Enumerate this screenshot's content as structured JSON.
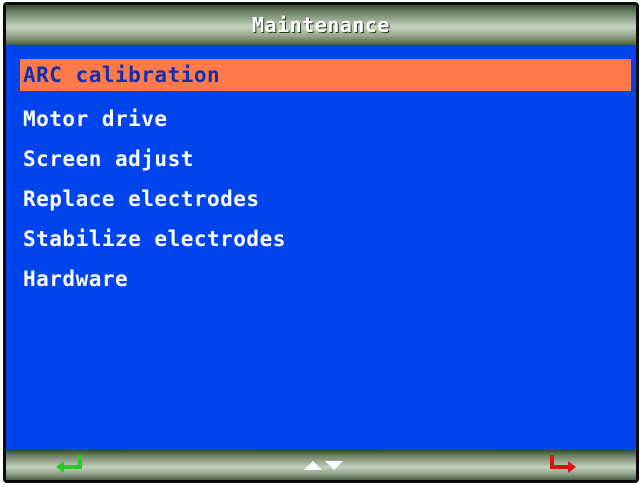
{
  "title": "Maintenance",
  "menu": {
    "items": [
      {
        "label": "ARC calibration",
        "selected": true
      },
      {
        "label": "Motor drive",
        "selected": false
      },
      {
        "label": "Screen adjust",
        "selected": false
      },
      {
        "label": "Replace electrodes",
        "selected": false
      },
      {
        "label": "Stabilize electrodes",
        "selected": false
      },
      {
        "label": "Hardware",
        "selected": false
      }
    ]
  },
  "softkeys": {
    "left": {
      "icon": "enter-arrow-icon",
      "color": "#22cc22"
    },
    "middle": {
      "icon": "up-down-arrows-icon",
      "color": "#ffffff"
    },
    "right": {
      "icon": "back-arrow-icon",
      "color": "#dd1111"
    }
  },
  "colors": {
    "screen_background": "#0044ee",
    "selection_highlight": "#ff7a4a",
    "selected_text": "#1030b0",
    "text": "#ffffff"
  }
}
